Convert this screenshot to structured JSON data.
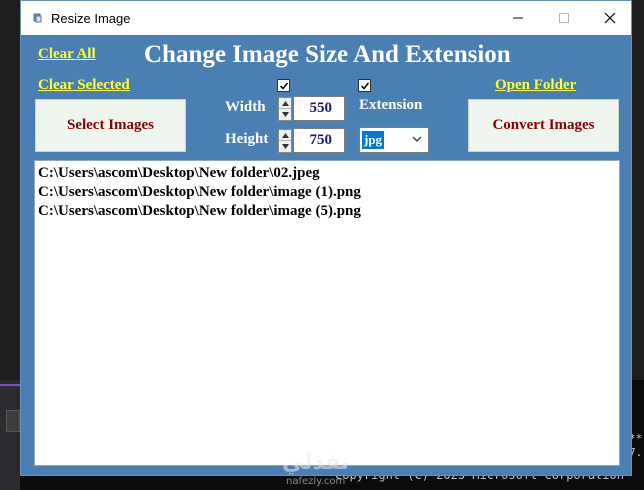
{
  "window": {
    "title": "Resize Image",
    "controls": {
      "minimize": "minimize-icon",
      "maximize": "maximize-icon",
      "close": "close-icon"
    }
  },
  "heading": "Change Image Size And Extension",
  "links": {
    "clear_all": "Clear All",
    "clear_selected": "Clear Selected",
    "open_folder": "Open Folder"
  },
  "buttons": {
    "select_images": "Select Images",
    "convert_images": "Convert Images"
  },
  "size": {
    "width_label": "Width",
    "width_value": "550",
    "height_label": "Height",
    "height_value": "750",
    "resize_checked": true
  },
  "extension": {
    "label": "Extension",
    "checked": true,
    "selected": "jpg"
  },
  "files": [
    "C:\\Users\\ascom\\Desktop\\New folder\\02.jpeg",
    "C:\\Users\\ascom\\Desktop\\New folder\\image (1).png",
    "C:\\Users\\ascom\\Desktop\\New folder\\image (5).png"
  ],
  "background": {
    "console_right": "**\n7.",
    "copyright": "Copyright (C) 2023 Microsoft Corporation",
    "watermark": "نفذلي",
    "watermark_url": "nafezly.com"
  },
  "colors": {
    "window_bg": "#4a7fb3",
    "link": "#ffff33",
    "button_text": "#8b0000",
    "selection": "#0078d7"
  }
}
